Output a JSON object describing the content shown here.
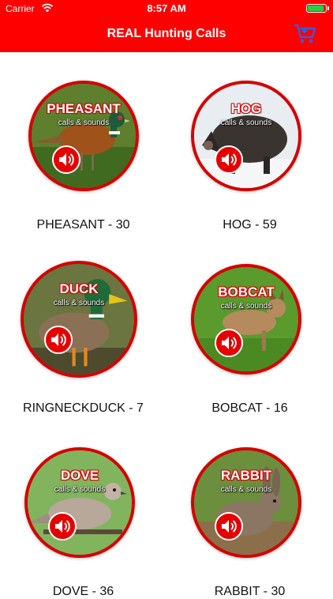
{
  "status": {
    "carrier": "Carrier",
    "time": "8:57 AM"
  },
  "header": {
    "title": "REAL Hunting Calls"
  },
  "animals": [
    {
      "id": "pheasant",
      "caption": "PHEASANT",
      "subcaption": "calls & sounds",
      "label": "PHEASANT - 30"
    },
    {
      "id": "hog",
      "caption": "HOG",
      "subcaption": "calls & sounds",
      "label": "HOG - 59"
    },
    {
      "id": "duck",
      "caption": "DUCK",
      "subcaption": "calls & sounds",
      "label": "RINGNECKDUCK - 7"
    },
    {
      "id": "bobcat",
      "caption": "BOBCAT",
      "subcaption": "calls & sounds",
      "label": "BOBCAT - 16"
    },
    {
      "id": "dove",
      "caption": "DOVE",
      "subcaption": "calls & sounds",
      "label": "DOVE - 36"
    },
    {
      "id": "rabbit",
      "caption": "RABBIT",
      "subcaption": "calls & sounds",
      "label": "RABBIT - 30"
    }
  ],
  "colors": {
    "bar": "#ff0000",
    "ring": "#d50000",
    "cart": "#3b5bdb"
  }
}
